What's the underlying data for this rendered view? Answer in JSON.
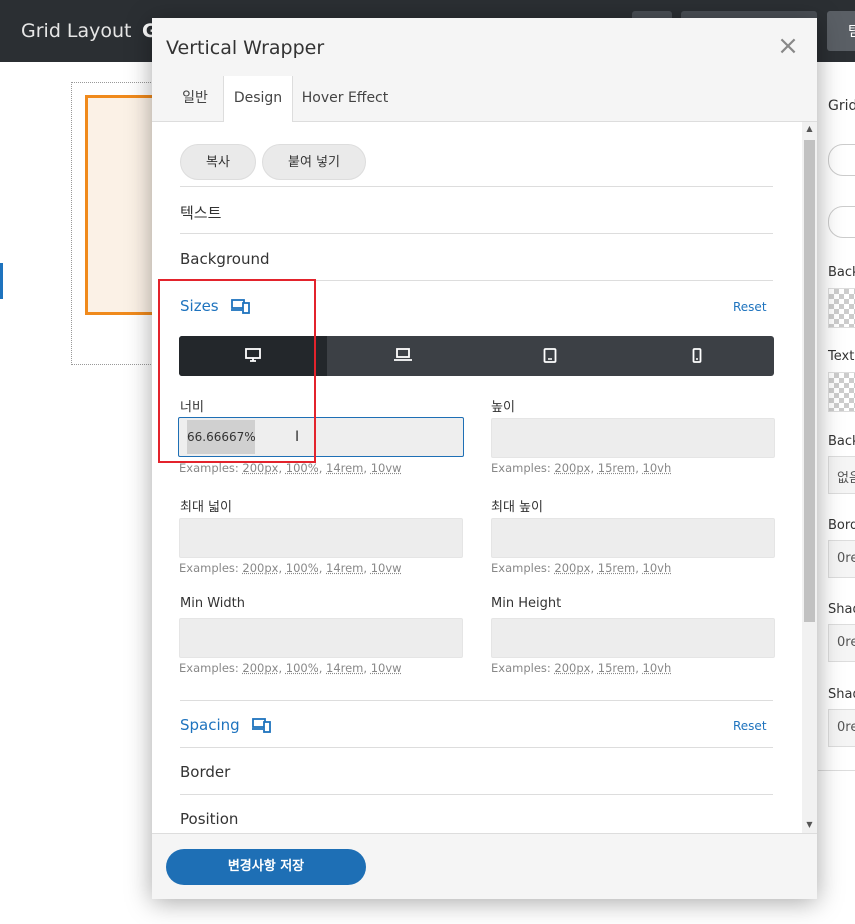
{
  "app": {
    "title": "Grid Layout",
    "title_next": "G",
    "top_button_text": "텀"
  },
  "right_panel": {
    "heading": "Grid",
    "labels": [
      "Back",
      "Text",
      "Back",
      "Bord",
      "Shad",
      "Shad"
    ],
    "select_value": "없음",
    "input_values": [
      "0re",
      "0re",
      "0re"
    ]
  },
  "modal": {
    "title": "Vertical Wrapper",
    "close_icon": "close-icon",
    "tabs": [
      "일반",
      "Design",
      "Hover Effect"
    ],
    "active_tab": "Design",
    "copy_label": "복사",
    "paste_label": "붙여 넣기",
    "sections": {
      "text": "텍스트",
      "background": "Background",
      "sizes": "Sizes",
      "spacing": "Spacing",
      "border": "Border",
      "position": "Position"
    },
    "reset_label": "Reset",
    "devices": [
      "desktop-icon",
      "laptop-icon",
      "tablet-icon",
      "mobile-icon"
    ],
    "active_device": "desktop",
    "fields": {
      "width_label": "너비",
      "width_value": "66.66667%",
      "height_label": "높이",
      "height_value": "",
      "max_width_label": "최대 넓이",
      "max_height_label": "최대 높이",
      "min_width_label": "Min Width",
      "min_height_label": "Min Height"
    },
    "examples_width": {
      "prefix": "Examples: ",
      "items": [
        "200px",
        "100%",
        "14rem",
        "10vw"
      ]
    },
    "examples_height": {
      "prefix": "Examples: ",
      "items": [
        "200px",
        "15rem",
        "10vh"
      ]
    },
    "save_label": "변경사항 저장"
  },
  "colors": {
    "accent": "#1e73be",
    "highlight_box": "#e3232c",
    "element_outline": "#f08a1c",
    "topbar": "#2b2f33"
  }
}
